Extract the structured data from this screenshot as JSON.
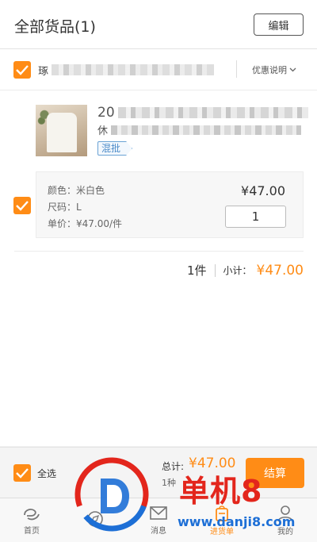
{
  "header": {
    "title": "全部货品(1)",
    "edit_label": "编辑"
  },
  "shop": {
    "name_prefix": "琢",
    "promo_label": "优惠说明"
  },
  "product": {
    "title_prefix": "20",
    "subtitle_prefix": "休",
    "tag": "混批",
    "sku": {
      "color": "颜色：米白色",
      "size": "尺码：L",
      "unit_price": "单价：¥47.00/件",
      "price": "¥47.00",
      "quantity": "1"
    }
  },
  "summary": {
    "count": "1件",
    "subtotal_label": "小计：",
    "subtotal_value": "¥47.00"
  },
  "bottom_bar": {
    "select_all": "全选",
    "total_label": "总计:",
    "total_value": "¥47.00",
    "kinds": "1种",
    "checkout": "结算"
  },
  "tabbar": {
    "items": [
      {
        "label": "首页",
        "icon": "home-icon"
      },
      {
        "label": "",
        "icon": "compass-icon"
      },
      {
        "label": "消息",
        "icon": "message-icon"
      },
      {
        "label": "进货单",
        "icon": "cart-icon"
      },
      {
        "label": "我的",
        "icon": "user-icon"
      }
    ]
  },
  "watermark": {
    "text": "单机8",
    "url": "www.danji8.com"
  },
  "colors": {
    "accent": "#ff8c16",
    "tag_blue": "#4a8ac8",
    "watermark_red": "#e3261c",
    "watermark_blue": "#1d6fd6"
  }
}
